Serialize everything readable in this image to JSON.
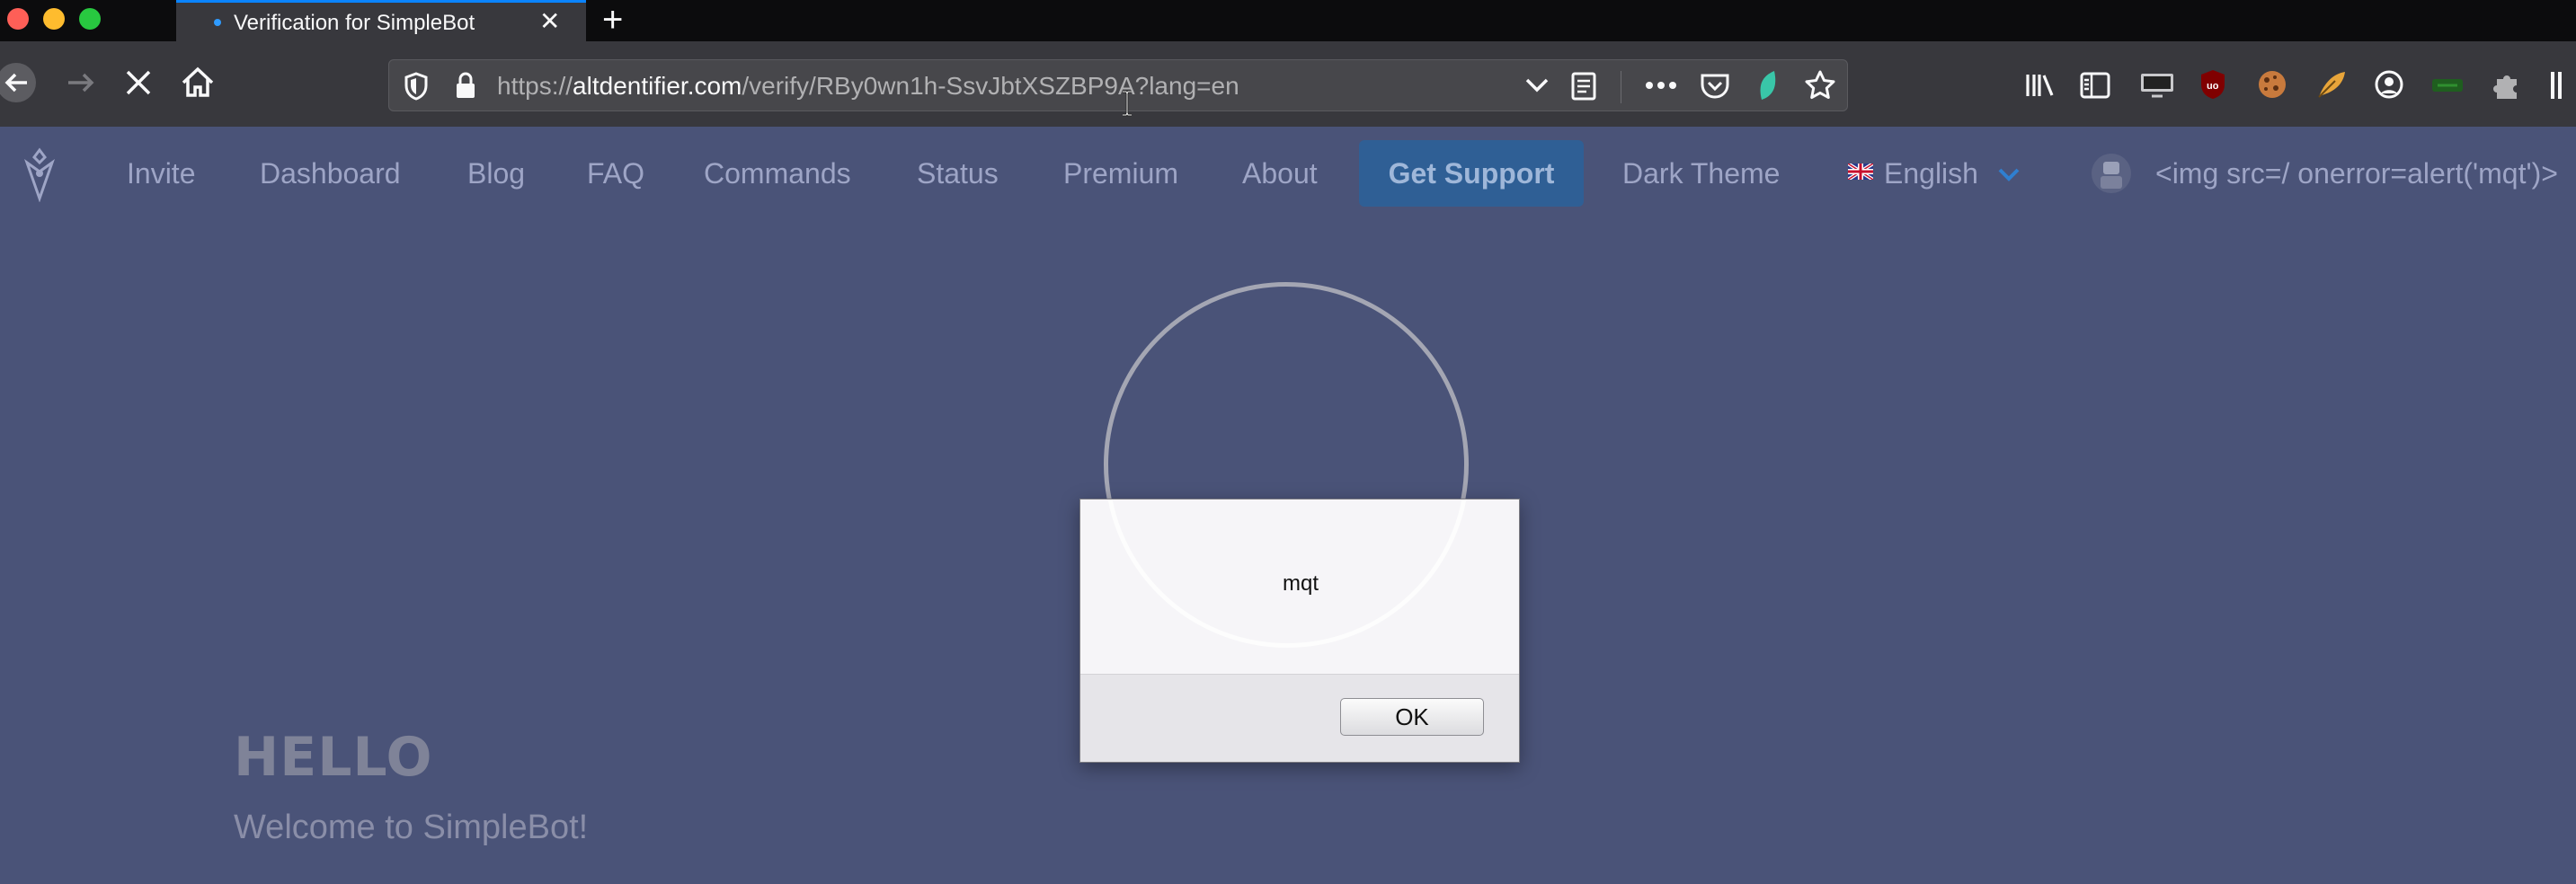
{
  "browser": {
    "tab": {
      "title": "Verification for SimpleBot",
      "close": "✕"
    },
    "new_tab": "+",
    "url": {
      "prefix": "https://",
      "host": "altdentifier.com",
      "path": "/verify/RBy0wn1h-SsvJbtXSZBP9A?lang=en"
    }
  },
  "site_nav": {
    "links": [
      "Invite",
      "Dashboard",
      "Blog",
      "FAQ",
      "Commands",
      "Status",
      "Premium",
      "About"
    ],
    "support": "Get Support",
    "dark_theme": "Dark Theme",
    "language": "English",
    "user": "<img src=/ onerror=alert('mqt')>"
  },
  "main": {
    "heading": "HELLO",
    "subheading": "Welcome to SimpleBot!"
  },
  "dialog": {
    "message": "mqt",
    "ok": "OK"
  }
}
